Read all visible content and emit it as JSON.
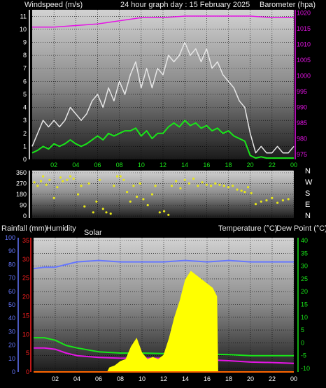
{
  "chart_data": [
    {
      "type": "line",
      "labels": {
        "left": "Windspeed (m/s)",
        "center": "24 hour graph day : 15 February 2025",
        "right": "Barometer (hpa)"
      },
      "x_ticks": [
        "02",
        "04",
        "06",
        "08",
        "10",
        "12",
        "14",
        "16",
        "18",
        "20",
        "22",
        "00"
      ],
      "y_left": {
        "ticks": [
          0,
          1,
          2,
          3,
          4,
          5,
          6,
          7,
          8,
          9,
          10,
          11
        ],
        "range": [
          0,
          11.5
        ]
      },
      "y_right": {
        "ticks": [
          975,
          980,
          985,
          990,
          995,
          1000,
          1005,
          1010,
          1015,
          1020
        ],
        "range": [
          973.5,
          1021
        ]
      },
      "series": [
        {
          "name": "gust",
          "axis": "left",
          "color": "#e6e6e6",
          "x": [
            0,
            0.5,
            1,
            1.5,
            2,
            2.5,
            3,
            3.5,
            4,
            4.5,
            5,
            5.5,
            6,
            6.5,
            7,
            7.5,
            8,
            8.5,
            9,
            9.5,
            10,
            10.5,
            11,
            11.5,
            12,
            12.5,
            13,
            13.5,
            14,
            14.5,
            15,
            15.5,
            16,
            16.5,
            17,
            17.5,
            18,
            18.5,
            19,
            19.5,
            20,
            20.5,
            21,
            21.5,
            22,
            22.5,
            23,
            23.5,
            24
          ],
          "values": [
            1,
            2,
            3,
            2.5,
            3,
            2.5,
            3,
            4,
            3.5,
            3,
            3.5,
            4.5,
            5,
            4,
            5.5,
            4.5,
            6,
            5,
            6.5,
            7.5,
            5.5,
            7,
            5.5,
            7,
            6.5,
            8,
            7.5,
            8,
            9,
            8,
            8.5,
            7.5,
            8.5,
            7,
            7.5,
            6.5,
            6,
            5.5,
            4.5,
            4,
            2,
            0.5,
            1,
            0.5,
            0.5,
            1,
            0.5,
            0.5,
            1
          ]
        },
        {
          "name": "wind",
          "axis": "left",
          "color": "#19e619",
          "x": [
            0,
            0.5,
            1,
            1.5,
            2,
            2.5,
            3,
            3.5,
            4,
            4.5,
            5,
            5.5,
            6,
            6.5,
            7,
            7.5,
            8,
            8.5,
            9,
            9.5,
            10,
            10.5,
            11,
            11.5,
            12,
            12.5,
            13,
            13.5,
            14,
            14.5,
            15,
            15.5,
            16,
            16.5,
            17,
            17.5,
            18,
            18.5,
            19,
            19.5,
            20,
            20.5,
            21,
            21.5,
            22,
            22.5,
            23,
            23.5,
            24
          ],
          "values": [
            0.5,
            0.7,
            1,
            0.8,
            1.2,
            1,
            1.2,
            1.5,
            1.2,
            1,
            1.2,
            1.5,
            1.8,
            1.5,
            2,
            1.8,
            2,
            2.2,
            2.2,
            2.4,
            1.8,
            2.2,
            1.6,
            2,
            2,
            2.5,
            2.8,
            2.5,
            3,
            2.6,
            2.8,
            2.4,
            2.6,
            2.2,
            2.4,
            2,
            2.2,
            1.8,
            1.6,
            1.4,
            0.3,
            0.1,
            0.2,
            0.1,
            0.1,
            0.1,
            0.1,
            0.1,
            0.1
          ]
        },
        {
          "name": "barometer",
          "axis": "right",
          "color": "#e614e6",
          "x": [
            0,
            2,
            4,
            6,
            8,
            10,
            12,
            14,
            16,
            18,
            20,
            22,
            24
          ],
          "values": [
            1015.5,
            1015.5,
            1016,
            1016.5,
            1017.5,
            1018.5,
            1018.5,
            1019,
            1019,
            1019,
            1019,
            1018.5,
            1018.5
          ]
        }
      ]
    },
    {
      "type": "scatter",
      "labels": [
        "N",
        "W",
        "S",
        "E",
        "N"
      ],
      "y_ticks": [
        360,
        270,
        180,
        90,
        0
      ],
      "y_range": [
        0,
        360
      ],
      "series": [
        {
          "name": "direction",
          "color": "#e6e619",
          "x": [
            0.2,
            0.5,
            0.8,
            1,
            1.3,
            1.6,
            2,
            2.3,
            2.6,
            2.8,
            3.2,
            3.5,
            3.8,
            4.2,
            4.5,
            4.8,
            5.2,
            5.6,
            5.9,
            6.2,
            6.5,
            6.8,
            7.2,
            7.5,
            7.8,
            8.1,
            8.4,
            8.7,
            9,
            9.3,
            9.6,
            9.9,
            10.2,
            10.6,
            11,
            11.3,
            11.7,
            12.1,
            12.5,
            12.8,
            13.2,
            13.6,
            14,
            14.4,
            14.8,
            15.2,
            15.6,
            16,
            16.4,
            16.8,
            17.2,
            17.6,
            18,
            18.4,
            18.8,
            19.2,
            19.5,
            19.8,
            20.1,
            20.5,
            21,
            21.5,
            22,
            22.5,
            23,
            23.5
          ],
          "values": [
            280,
            250,
            290,
            330,
            260,
            300,
            150,
            240,
            320,
            290,
            300,
            330,
            310,
            180,
            250,
            80,
            270,
            30,
            120,
            300,
            60,
            30,
            20,
            250,
            330,
            330,
            300,
            200,
            120,
            250,
            160,
            270,
            140,
            90,
            180,
            250,
            30,
            40,
            10,
            250,
            290,
            230,
            300,
            270,
            310,
            250,
            280,
            260,
            250,
            270,
            260,
            250,
            240,
            250,
            220,
            210,
            200,
            240,
            190,
            100,
            120,
            130,
            150,
            110,
            130,
            140
          ]
        }
      ]
    },
    {
      "type": "line",
      "labels": {
        "rain": "Rainfall (mm)",
        "humidity": "Humidity",
        "solar": "Solar",
        "temperature": "Temperature (°C)",
        "dewpoint": "Dew Point (°C)"
      },
      "x_ticks": [
        "02",
        "04",
        "06",
        "08",
        "10",
        "12",
        "14",
        "16",
        "18",
        "20",
        "22",
        "00"
      ],
      "humidity_ticks": [
        0,
        10,
        20,
        30,
        40,
        50,
        60,
        70,
        80,
        90,
        100
      ],
      "rain_ticks": [
        0,
        5,
        10,
        15,
        20,
        25,
        30,
        35
      ],
      "temp_ticks": [
        -10,
        -5,
        0,
        5,
        10,
        15,
        20,
        25,
        30,
        35,
        40
      ],
      "series": [
        {
          "name": "humidity",
          "axis": "humidity",
          "color": "#6677ff",
          "x": [
            0,
            1,
            2,
            3,
            4,
            6,
            8,
            10,
            12,
            14,
            16,
            18,
            20,
            22,
            24
          ],
          "values": [
            77,
            78,
            78,
            80,
            82,
            83,
            82,
            82,
            82,
            83,
            82,
            83,
            82,
            82,
            82
          ]
        },
        {
          "name": "temperature",
          "axis": "temperature",
          "color": "#19e619",
          "x": [
            0,
            1,
            2,
            3,
            4,
            6,
            8,
            10,
            12,
            14,
            16,
            18,
            20,
            22,
            24
          ],
          "values": [
            2,
            2,
            1,
            -1,
            -2,
            -3.5,
            -4,
            -4,
            -4.2,
            -4.2,
            -4.4,
            -4.6,
            -5,
            -5,
            -5
          ]
        },
        {
          "name": "dewpoint",
          "axis": "temperature",
          "color": "#e614e6",
          "x": [
            0,
            1,
            2,
            3,
            4,
            6,
            8,
            10,
            12,
            14,
            16,
            18,
            20,
            22,
            24
          ],
          "values": [
            -2,
            -2,
            -2.5,
            -4,
            -5,
            -5.7,
            -6,
            -6,
            -6,
            -6.3,
            -6.6,
            -7,
            -7.5,
            -7.7,
            -8
          ]
        },
        {
          "name": "solar",
          "axis": "solar",
          "color": "#ffff00",
          "x": [
            6.8,
            7,
            7.5,
            8,
            8.5,
            9,
            9.5,
            10,
            10.5,
            11,
            11.5,
            12,
            12.5,
            13,
            13.5,
            14,
            14.5,
            15,
            15.5,
            16,
            16.5,
            16.9,
            17
          ],
          "values": [
            0,
            10,
            15,
            25,
            30,
            60,
            80,
            45,
            30,
            35,
            30,
            40,
            80,
            130,
            170,
            220,
            240,
            230,
            220,
            210,
            200,
            180,
            0
          ]
        },
        {
          "name": "rain",
          "axis": "rain",
          "color": "#ff6600",
          "x": [
            0,
            24
          ],
          "values": [
            0,
            0
          ]
        }
      ]
    }
  ]
}
